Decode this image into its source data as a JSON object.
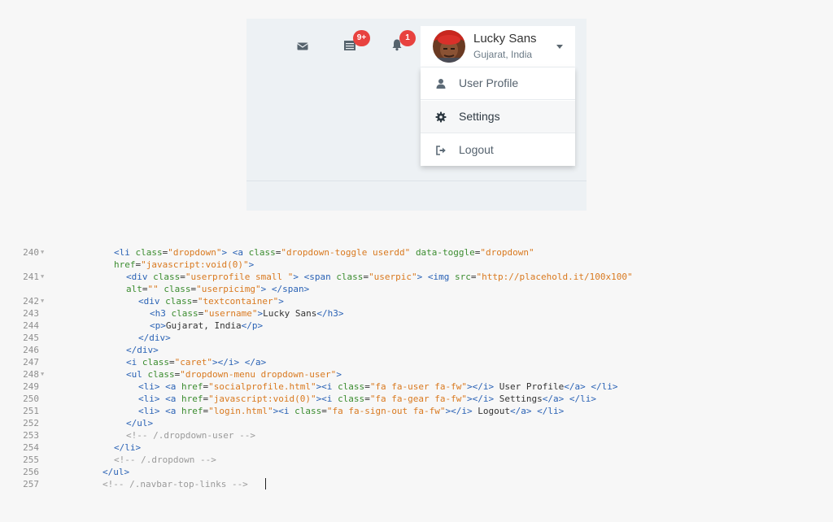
{
  "preview": {
    "nav_icons": [
      {
        "icon": "envelope-icon"
      },
      {
        "icon": "tasks-icon",
        "badge": "9+"
      },
      {
        "icon": "bell-icon",
        "badge": "1"
      }
    ],
    "user": {
      "name": "Lucky Sans",
      "location": "Gujarat, India",
      "avatar": "user-avatar"
    },
    "dropdown": [
      {
        "label": "User Profile",
        "icon": "user-icon"
      },
      {
        "label": "Settings",
        "icon": "gear-icon"
      },
      {
        "label": "Logout",
        "icon": "sign-out-icon"
      }
    ]
  },
  "colors": {
    "badge": "#e8423f",
    "tag": "#2a62b5",
    "attribute": "#3b8c2f",
    "value": "#d9791f",
    "comment": "#9a9a9a"
  },
  "code": {
    "line_numbers": [
      "240",
      "241",
      "242",
      "243",
      "244",
      "245",
      "246",
      "247",
      "248",
      "249",
      "250",
      "251",
      "252",
      "253",
      "254",
      "255",
      "256",
      "257"
    ],
    "fold_marker": "▼",
    "lines": [
      [
        {
          "k": "t",
          "s": "<li "
        },
        {
          "k": "a",
          "s": "class"
        },
        {
          "k": "tx",
          "s": "="
        },
        {
          "k": "v",
          "s": "\"dropdown\""
        },
        {
          "k": "t",
          "s": "> <a "
        },
        {
          "k": "a",
          "s": "class"
        },
        {
          "k": "tx",
          "s": "="
        },
        {
          "k": "v",
          "s": "\"dropdown-toggle userdd\""
        },
        {
          "k": "tx",
          "s": " "
        },
        {
          "k": "a",
          "s": "data-toggle"
        },
        {
          "k": "tx",
          "s": "="
        },
        {
          "k": "v",
          "s": "\"dropdown\""
        }
      ],
      [
        {
          "k": "a",
          "s": "href"
        },
        {
          "k": "tx",
          "s": "="
        },
        {
          "k": "v",
          "s": "\"javascript:void(0)\""
        },
        {
          "k": "t",
          "s": ">"
        }
      ],
      [
        {
          "k": "t",
          "s": "<div "
        },
        {
          "k": "a",
          "s": "class"
        },
        {
          "k": "tx",
          "s": "="
        },
        {
          "k": "v",
          "s": "\"userprofile small \""
        },
        {
          "k": "t",
          "s": "> <span "
        },
        {
          "k": "a",
          "s": "class"
        },
        {
          "k": "tx",
          "s": "="
        },
        {
          "k": "v",
          "s": "\"userpic\""
        },
        {
          "k": "t",
          "s": "> <img "
        },
        {
          "k": "a",
          "s": "src"
        },
        {
          "k": "tx",
          "s": "="
        },
        {
          "k": "v",
          "s": "\"http://placehold.it/100x100\""
        }
      ],
      [
        {
          "k": "a",
          "s": "alt"
        },
        {
          "k": "tx",
          "s": "="
        },
        {
          "k": "v",
          "s": "\"\""
        },
        {
          "k": "tx",
          "s": " "
        },
        {
          "k": "a",
          "s": "class"
        },
        {
          "k": "tx",
          "s": "="
        },
        {
          "k": "v",
          "s": "\"userpicimg\""
        },
        {
          "k": "t",
          "s": "> </span>"
        }
      ],
      [
        {
          "k": "t",
          "s": "<div "
        },
        {
          "k": "a",
          "s": "class"
        },
        {
          "k": "tx",
          "s": "="
        },
        {
          "k": "v",
          "s": "\"textcontainer\""
        },
        {
          "k": "t",
          "s": ">"
        }
      ],
      [
        {
          "k": "t",
          "s": "<h3 "
        },
        {
          "k": "a",
          "s": "class"
        },
        {
          "k": "tx",
          "s": "="
        },
        {
          "k": "v",
          "s": "\"username\""
        },
        {
          "k": "t",
          "s": ">"
        },
        {
          "k": "tx",
          "s": "Lucky Sans"
        },
        {
          "k": "t",
          "s": "</h3>"
        }
      ],
      [
        {
          "k": "t",
          "s": "<p>"
        },
        {
          "k": "tx",
          "s": "Gujarat, India"
        },
        {
          "k": "t",
          "s": "</p>"
        }
      ],
      [
        {
          "k": "t",
          "s": "</div>"
        }
      ],
      [
        {
          "k": "t",
          "s": "</div>"
        }
      ],
      [
        {
          "k": "t",
          "s": "<i "
        },
        {
          "k": "a",
          "s": "class"
        },
        {
          "k": "tx",
          "s": "="
        },
        {
          "k": "v",
          "s": "\"caret\""
        },
        {
          "k": "t",
          "s": "></i> </a>"
        }
      ],
      [
        {
          "k": "t",
          "s": "<ul "
        },
        {
          "k": "a",
          "s": "class"
        },
        {
          "k": "tx",
          "s": "="
        },
        {
          "k": "v",
          "s": "\"dropdown-menu dropdown-user\""
        },
        {
          "k": "t",
          "s": ">"
        }
      ],
      [
        {
          "k": "t",
          "s": "<li> <a "
        },
        {
          "k": "a",
          "s": "href"
        },
        {
          "k": "tx",
          "s": "="
        },
        {
          "k": "v",
          "s": "\"socialprofile.html\""
        },
        {
          "k": "t",
          "s": "><i "
        },
        {
          "k": "a",
          "s": "class"
        },
        {
          "k": "tx",
          "s": "="
        },
        {
          "k": "v",
          "s": "\"fa fa-user fa-fw\""
        },
        {
          "k": "t",
          "s": "></i>"
        },
        {
          "k": "tx",
          "s": " User Profile"
        },
        {
          "k": "t",
          "s": "</a> </li>"
        }
      ],
      [
        {
          "k": "t",
          "s": "<li> <a "
        },
        {
          "k": "a",
          "s": "href"
        },
        {
          "k": "tx",
          "s": "="
        },
        {
          "k": "v",
          "s": "\"javascript:void(0)\""
        },
        {
          "k": "t",
          "s": "><i "
        },
        {
          "k": "a",
          "s": "class"
        },
        {
          "k": "tx",
          "s": "="
        },
        {
          "k": "v",
          "s": "\"fa fa-gear fa-fw\""
        },
        {
          "k": "t",
          "s": "></i>"
        },
        {
          "k": "tx",
          "s": " Settings"
        },
        {
          "k": "t",
          "s": "</a> </li>"
        }
      ],
      [
        {
          "k": "t",
          "s": "<li> <a "
        },
        {
          "k": "a",
          "s": "href"
        },
        {
          "k": "tx",
          "s": "="
        },
        {
          "k": "v",
          "s": "\"login.html\""
        },
        {
          "k": "t",
          "s": "><i "
        },
        {
          "k": "a",
          "s": "class"
        },
        {
          "k": "tx",
          "s": "="
        },
        {
          "k": "v",
          "s": "\"fa fa-sign-out fa-fw\""
        },
        {
          "k": "t",
          "s": "></i>"
        },
        {
          "k": "tx",
          "s": " Logout"
        },
        {
          "k": "t",
          "s": "</a> </li>"
        }
      ],
      [
        {
          "k": "t",
          "s": "</ul>"
        }
      ],
      [
        {
          "k": "c",
          "s": "<!-- /.dropdown-user -->"
        }
      ],
      [
        {
          "k": "t",
          "s": "</li>"
        }
      ],
      [
        {
          "k": "c",
          "s": "<!-- /.dropdown -->"
        }
      ],
      [
        {
          "k": "t",
          "s": "</ul>"
        }
      ],
      [
        {
          "k": "c",
          "s": "<!-- /.navbar-top-links -->"
        }
      ]
    ]
  }
}
